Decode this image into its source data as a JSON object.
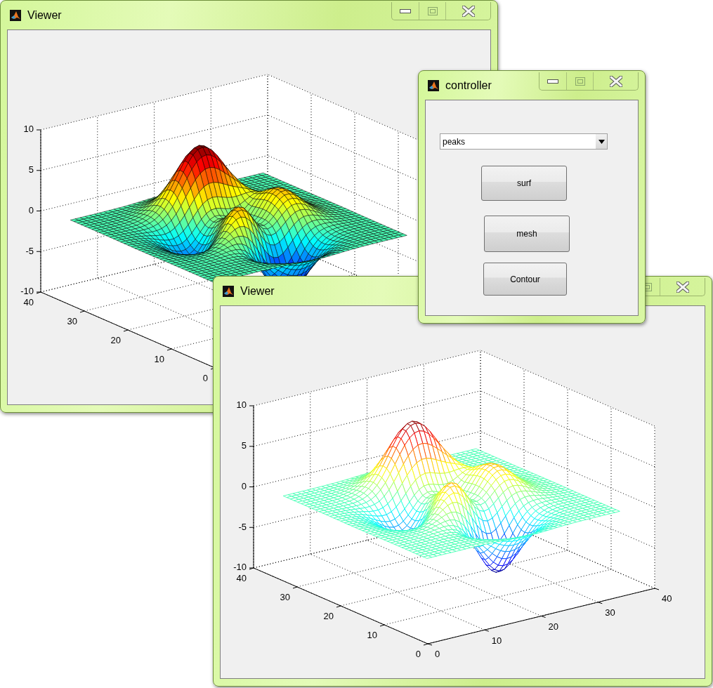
{
  "windows": [
    {
      "kind": "viewer",
      "title": "Viewer",
      "plot": {
        "kind": "surf",
        "z_ticks": [
          "10",
          "5",
          "0",
          "-5",
          "-10"
        ],
        "y_ticks": [
          "40",
          "30",
          "20",
          "10",
          "0"
        ]
      }
    },
    {
      "kind": "controller",
      "title": "controller",
      "dropdown": {
        "value": "peaks"
      },
      "buttons": [
        "surf",
        "mesh",
        "Contour"
      ]
    },
    {
      "kind": "viewer",
      "title": "Viewer",
      "plot": {
        "kind": "mesh",
        "z_ticks": [
          "10",
          "5",
          "0",
          "-5",
          "-10"
        ],
        "y_ticks": [
          "40",
          "30",
          "20",
          "10",
          "0"
        ],
        "x_ticks": [
          "0",
          "10",
          "20",
          "30",
          "40"
        ]
      }
    }
  ]
}
